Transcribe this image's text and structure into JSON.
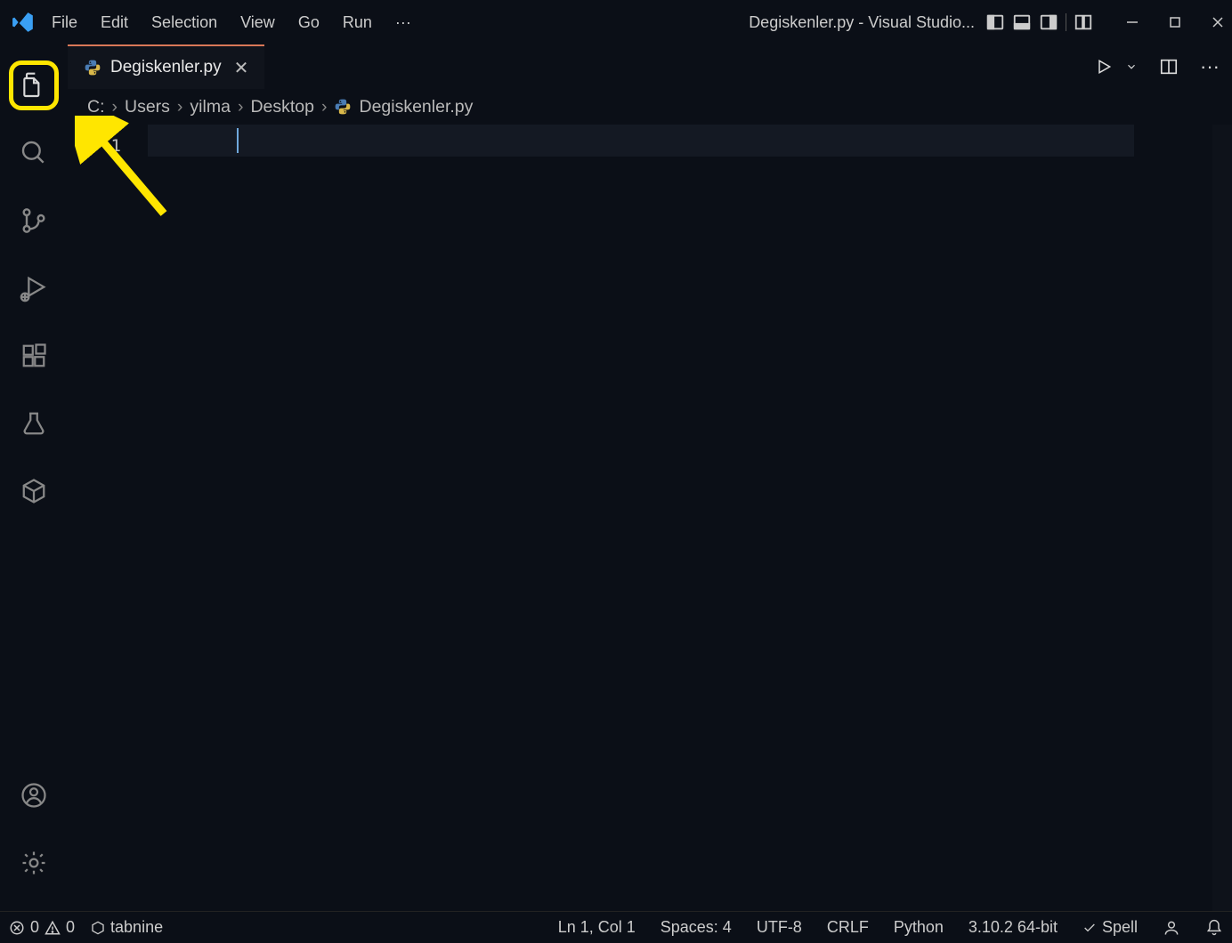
{
  "window": {
    "title": "Degiskenler.py - Visual Studio..."
  },
  "menu": {
    "items": [
      "File",
      "Edit",
      "Selection",
      "View",
      "Go",
      "Run"
    ],
    "more": "···"
  },
  "tab": {
    "filename": "Degiskenler.py"
  },
  "breadcrumb": {
    "items": [
      "C:",
      "Users",
      "yilma",
      "Desktop",
      "Degiskenler.py"
    ]
  },
  "editor": {
    "lineNumber": "1"
  },
  "status": {
    "errors": "0",
    "warnings": "0",
    "tabnine": "tabnine",
    "cursor": "Ln 1, Col 1",
    "spaces": "Spaces: 4",
    "encoding": "UTF-8",
    "eol": "CRLF",
    "language": "Python",
    "interpreter": "3.10.2 64-bit",
    "spell": "Spell"
  }
}
